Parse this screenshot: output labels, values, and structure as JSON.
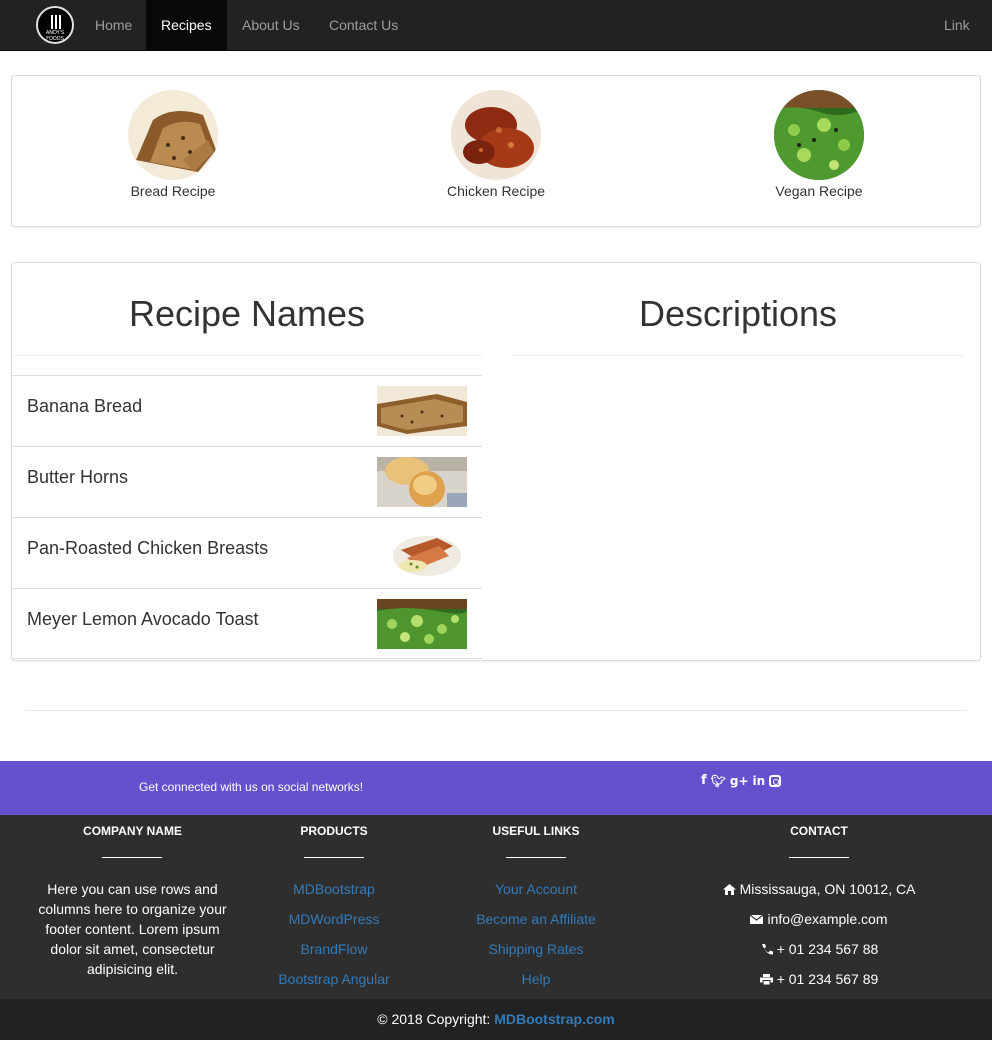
{
  "nav": {
    "logo_text": "ANDY'S\nFOODS",
    "items": [
      "Home",
      "Recipes",
      "About Us",
      "Contact Us"
    ],
    "active": "Recipes",
    "right_link": "Link"
  },
  "categories": [
    {
      "label": "Bread Recipe"
    },
    {
      "label": "Chicken Recipe"
    },
    {
      "label": "Vegan Recipe"
    }
  ],
  "recipes_section": {
    "left_title": "Recipe Names",
    "right_title": "Descriptions",
    "items": [
      {
        "name": "Banana Bread"
      },
      {
        "name": "Butter Horns"
      },
      {
        "name": "Pan-Roasted Chicken Breasts"
      },
      {
        "name": "Meyer Lemon Avocado Toast"
      }
    ]
  },
  "footer": {
    "social_text": "Get connected with us on social networks!",
    "social_icons": [
      "facebook-icon",
      "twitter-icon",
      "google-plus-icon",
      "linkedin-icon",
      "instagram-icon"
    ],
    "columns": {
      "company": {
        "heading": "COMPANY NAME",
        "text": "Here you can use rows and columns here to organize your footer content. Lorem ipsum dolor sit amet, consectetur adipisicing elit."
      },
      "products": {
        "heading": "PRODUCTS",
        "links": [
          "MDBootstrap",
          "MDWordPress",
          "BrandFlow",
          "Bootstrap Angular"
        ]
      },
      "useful": {
        "heading": "USEFUL LINKS",
        "links": [
          "Your Account",
          "Become an Affiliate",
          "Shipping Rates",
          "Help"
        ]
      },
      "contact": {
        "heading": "CONTACT",
        "address": "Mississauga, ON 10012, CA",
        "email": "info@example.com",
        "phone": "+ 01 234 567 88",
        "fax": "+ 01 234 567 89"
      }
    },
    "copyright_prefix": "© 2018 Copyright: ",
    "copyright_link": "MDBootstrap.com"
  },
  "colors": {
    "navbar": "#222222",
    "accent_purple": "#6351ce",
    "footer_bg": "#2e2e2e",
    "link": "#337ab7"
  }
}
